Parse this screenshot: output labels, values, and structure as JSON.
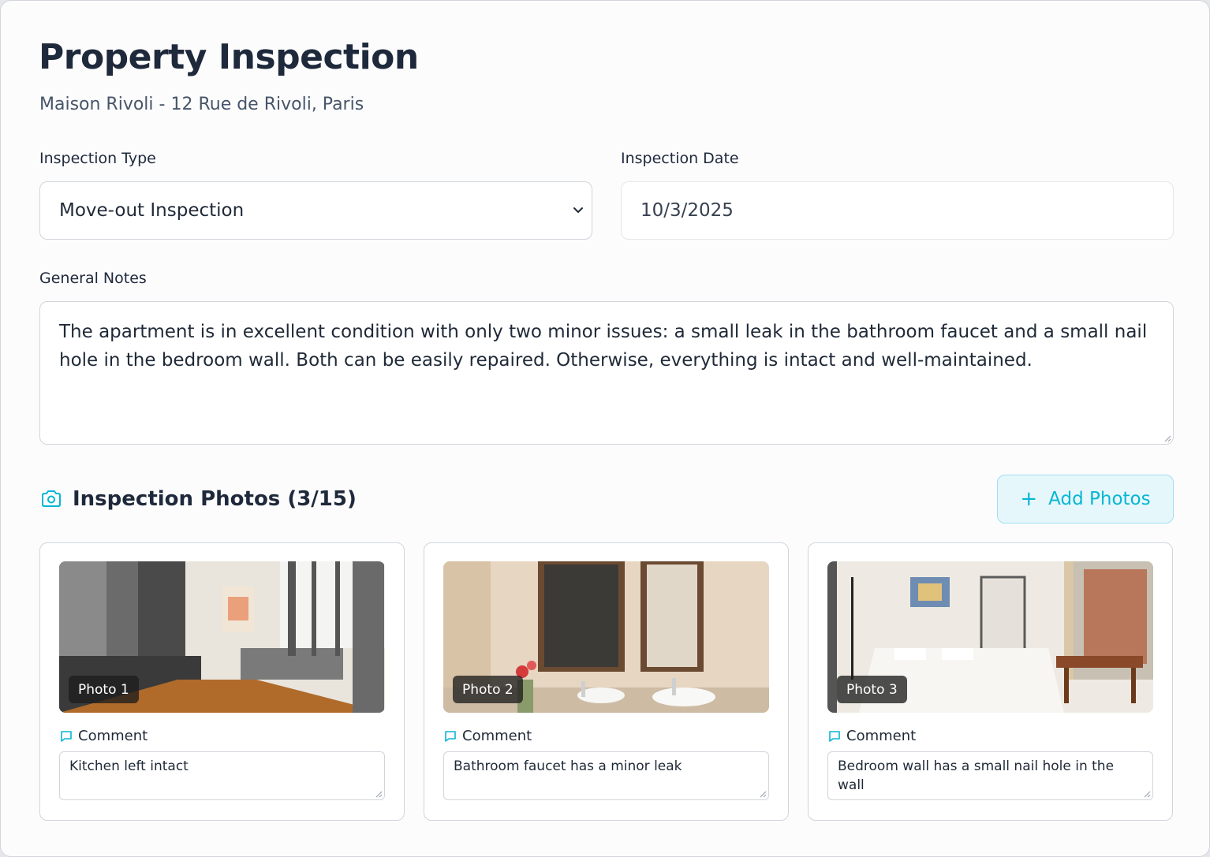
{
  "header": {
    "title": "Property Inspection",
    "subtitle": "Maison Rivoli - 12 Rue de Rivoli, Paris"
  },
  "form": {
    "inspection_type": {
      "label": "Inspection Type",
      "value": "Move-out Inspection",
      "icon": "chevron-down-icon"
    },
    "inspection_date": {
      "label": "Inspection Date",
      "value": "10/3/2025"
    },
    "general_notes": {
      "label": "General Notes",
      "value": "The apartment is in excellent condition with only two minor issues: a small leak in the bathroom faucet and a small nail hole in the bedroom wall. Both can be easily repaired. Otherwise, everything is intact and well-maintained."
    }
  },
  "photos": {
    "heading": "Inspection Photos (3/15)",
    "icon": "camera-icon",
    "add_button": "Add Photos",
    "accent_color": "#06b6d4",
    "items": [
      {
        "tag": "Photo 1",
        "comment_label": "Comment",
        "comment": "Kitchen left intact"
      },
      {
        "tag": "Photo 2",
        "comment_label": "Comment",
        "comment": "Bathroom faucet has a minor leak"
      },
      {
        "tag": "Photo 3",
        "comment_label": "Comment",
        "comment": "Bedroom wall has a small nail hole in the wall"
      }
    ]
  }
}
